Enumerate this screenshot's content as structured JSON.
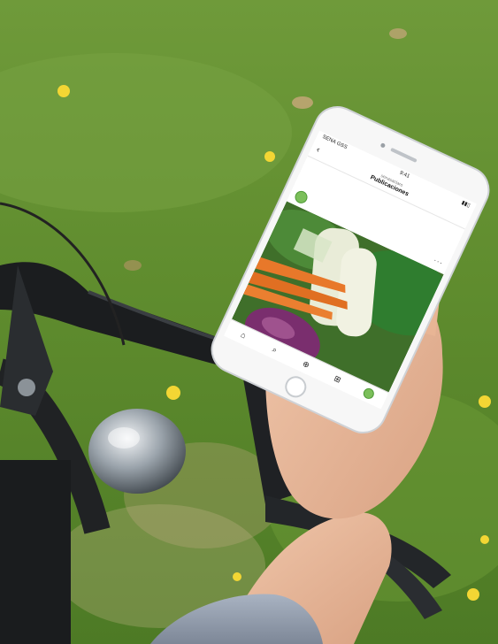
{
  "status_bar": {
    "carrier": "SENA GSS",
    "time": "9:41"
  },
  "header": {
    "account": "senasaclaro",
    "title": "Publicaciones"
  },
  "post": {
    "caption": "",
    "author_name": "",
    "author_subtitle": "",
    "overlay_text": ""
  },
  "tabbar": {
    "home_icon": "home-icon",
    "search_icon": "search-icon",
    "add_icon": "add-post-icon",
    "shop_icon": "shop-icon",
    "profile_icon": "profile-avatar"
  }
}
